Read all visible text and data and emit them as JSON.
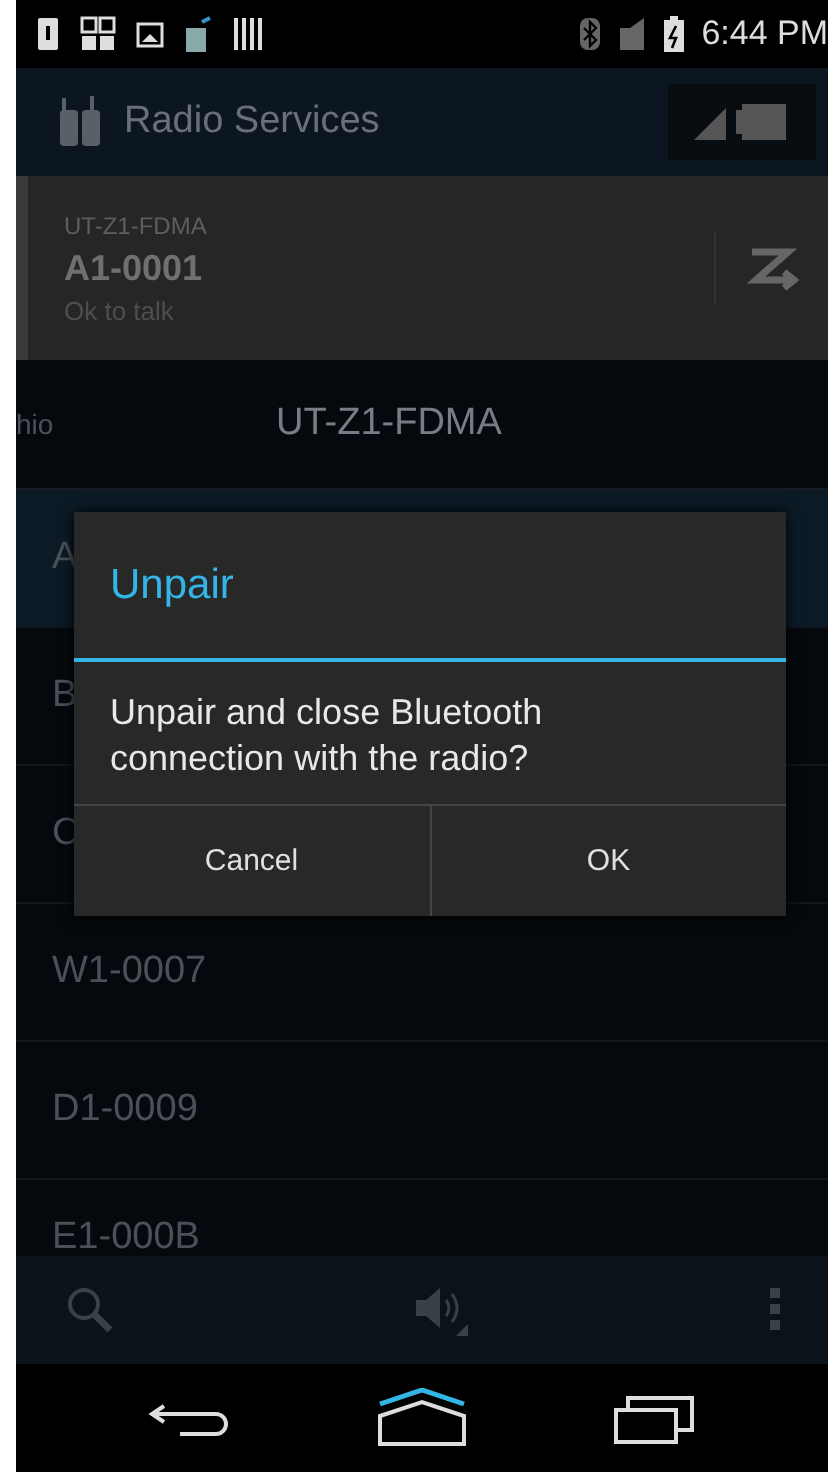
{
  "status_bar": {
    "time": "6:44 PM"
  },
  "action_bar": {
    "title": "Radio Services"
  },
  "radio_card": {
    "zone": "UT-Z1-FDMA",
    "channel": "A1-0001",
    "status": "Ok to talk"
  },
  "zone_pager": {
    "previous": "hio",
    "current": "UT-Z1-FDMA"
  },
  "channels": [
    {
      "name": "A",
      "selected": true
    },
    {
      "name": "B",
      "selected": false
    },
    {
      "name": "C",
      "selected": false
    },
    {
      "name": "W1-0007",
      "selected": false
    },
    {
      "name": "D1-0009",
      "selected": false
    },
    {
      "name": "E1-000B",
      "selected": false
    }
  ],
  "dialog": {
    "title": "Unpair",
    "message": "Unpair and close Bluetooth connection with the radio?",
    "buttons": [
      "Cancel",
      "OK"
    ]
  }
}
